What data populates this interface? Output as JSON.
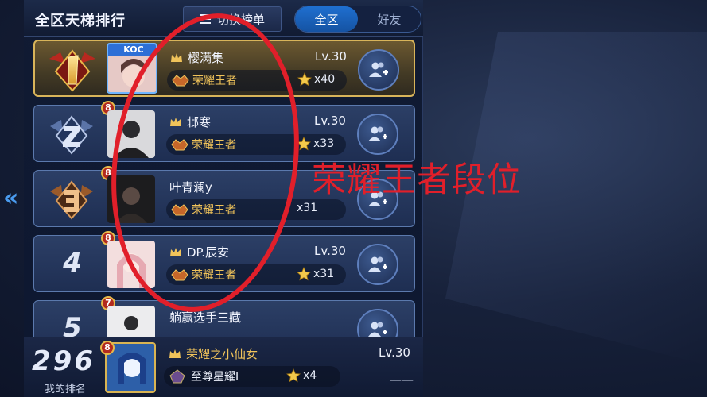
{
  "header": {
    "title": "全区天梯排行",
    "switch_label": "切换榜单",
    "scope_all": "全区",
    "scope_friends": "好友"
  },
  "rows": [
    {
      "rank": "1",
      "level": "",
      "name": "樱满集",
      "avatar_tag": "KOC",
      "tier": "荣耀王者",
      "lv": "Lv.30",
      "stars": "x40"
    },
    {
      "rank": "2",
      "level": "8",
      "name": "邶寒",
      "tier": "荣耀王者",
      "lv": "Lv.30",
      "stars": "x33"
    },
    {
      "rank": "3",
      "level": "8",
      "name": "叶青澜y",
      "tier": "荣耀王者",
      "lv": "",
      "stars": "x31"
    },
    {
      "rank": "4",
      "level": "8",
      "name": "DP.辰安",
      "tier": "荣耀王者",
      "lv": "Lv.30",
      "stars": "x31"
    },
    {
      "rank": "5",
      "level": "7",
      "name": "躺赢选手三藏",
      "tier": "",
      "lv": "",
      "stars": ""
    }
  ],
  "my_rank": {
    "rank": "296",
    "label": "我的排名",
    "level": "8",
    "name": "荣耀之小仙女",
    "tier": "至尊星耀I",
    "stars": "x4",
    "lv": "Lv.30",
    "extra": "——"
  },
  "annotation": {
    "text": "荣耀王者段位",
    "color": "#e11f2a"
  },
  "colors": {
    "gold_border": "#d8b45a",
    "accent_blue": "#1f6fd0",
    "tier_gold": "#f0c35a"
  }
}
